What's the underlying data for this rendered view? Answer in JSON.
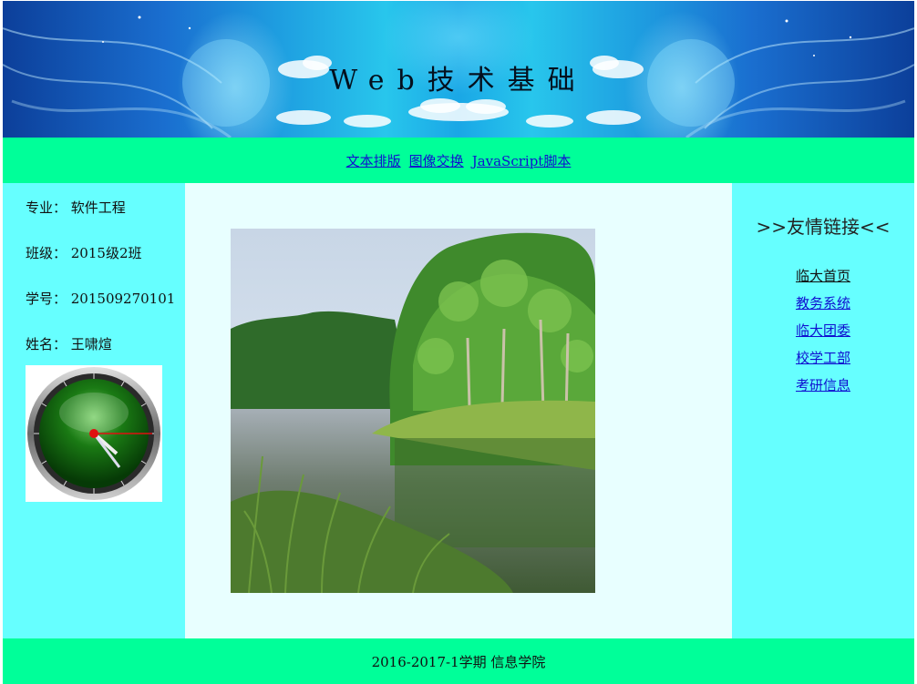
{
  "header": {
    "title": "Web技术基础"
  },
  "nav": {
    "items": [
      "文本排版",
      "图像交换",
      "JavaScript脚本"
    ]
  },
  "left": {
    "major": "专业：  软件工程",
    "class": "班级：  2015级2班",
    "student_id": "学号：  201509270101",
    "name": "姓名：  王啸煊"
  },
  "right": {
    "title": ">>友情链接<<",
    "links": [
      "临大首页",
      "教务系统",
      "临大团委",
      "校学工部",
      "考研信息"
    ]
  },
  "footer": {
    "text": "2016-2017-1学期  信息学院"
  },
  "colors": {
    "nav_bg": "#00ff99",
    "side_bg": "#66ffff",
    "main_bg": "#e8ffff",
    "link": "#1010d0"
  }
}
